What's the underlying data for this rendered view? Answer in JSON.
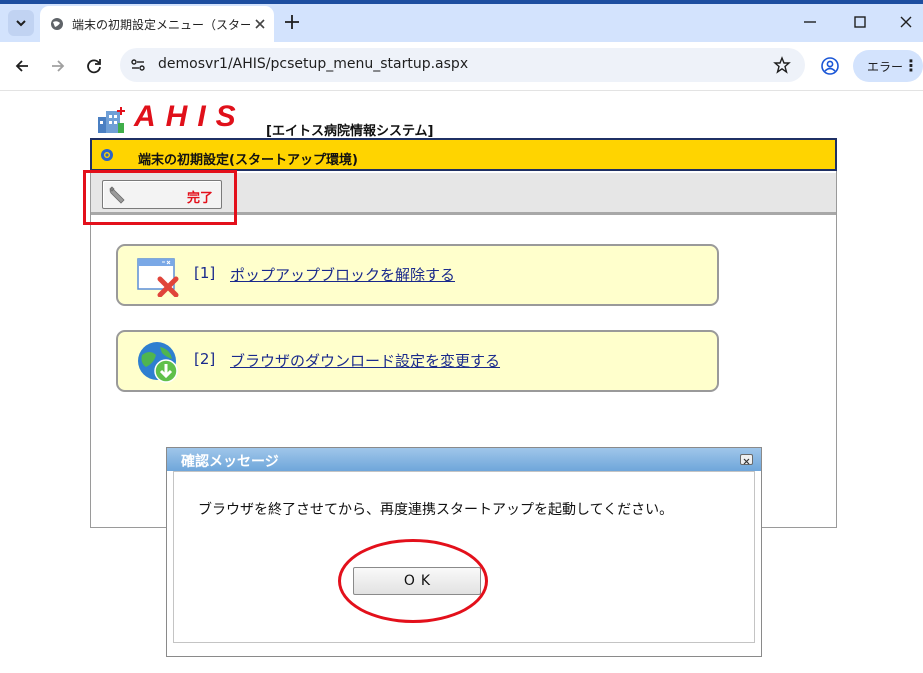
{
  "browser": {
    "tab_title": "端末の初期設定メニュー（スタートア",
    "url": "demosvr1/AHIS/pcsetup_menu_startup.aspx",
    "error_chip_label": "エラー",
    "error_chip_more": "⋮"
  },
  "header": {
    "logo_text": "AHIS",
    "system_name": "[エイトス病院情報システム]"
  },
  "title_bar": {
    "text": "端末の初期設定(スタートアップ環境)"
  },
  "toolbar": {
    "done_label": "完了"
  },
  "menu": {
    "items": [
      {
        "number": "[1]",
        "label": "ポップアップブロックを解除する",
        "icon": "popup-block-icon"
      },
      {
        "number": "[2]",
        "label": "ブラウザのダウンロード設定を変更する",
        "icon": "globe-download-icon"
      }
    ]
  },
  "dialog": {
    "title": "確認メッセージ",
    "message": "ブラウザを終了させてから、再度連携スタートアップを起動してください。",
    "ok_label": "OK"
  },
  "colors": {
    "title_bar_bg": "#ffd400",
    "highlight_red": "#e3101b",
    "menu_card_bg": "#ffffcc",
    "link_color": "#1a2a8c"
  }
}
